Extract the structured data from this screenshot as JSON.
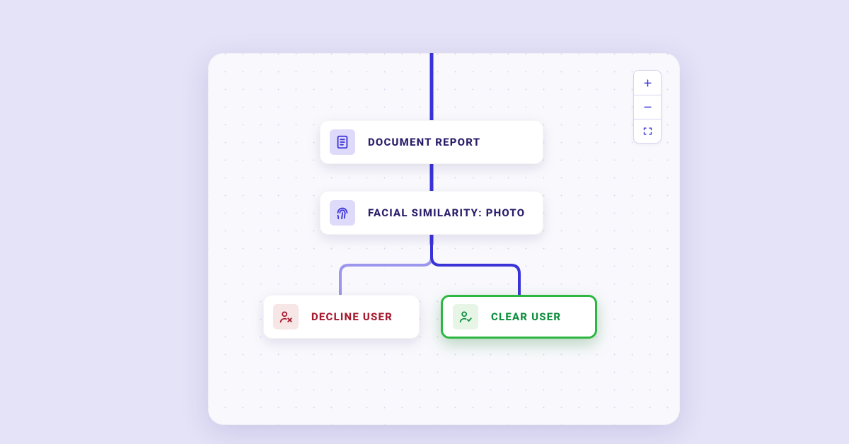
{
  "nodes": {
    "document_report": {
      "label": "DOCUMENT REPORT",
      "icon": "document-icon"
    },
    "facial_similarity": {
      "label": "FACIAL SIMILARITY: PHOTO",
      "icon": "fingerprint-icon"
    },
    "decline_user": {
      "label": "DECLINE USER",
      "icon": "user-x-icon"
    },
    "clear_user": {
      "label": "CLEAR USER",
      "icon": "user-check-icon",
      "selected": true
    }
  },
  "controls": {
    "zoom_in": "plus-icon",
    "zoom_out": "minus-icon",
    "fit": "fit-icon"
  },
  "colors": {
    "primary": "#3b33d8",
    "green": "#2db742",
    "red": "#a61b30",
    "page_bg": "#e5e3f7"
  }
}
